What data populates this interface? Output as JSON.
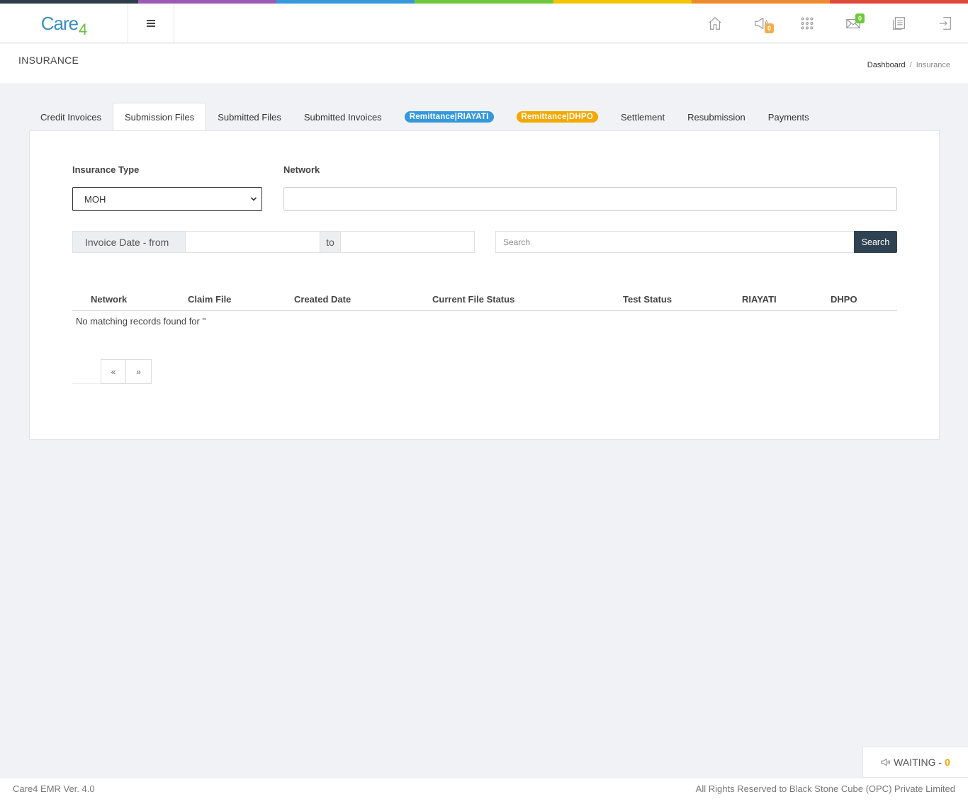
{
  "colors": {
    "stripe": [
      "#2f3d4a",
      "#9b59b6",
      "#3498db",
      "#6dc93a",
      "#f5c400",
      "#ee8a2b",
      "#e0483a"
    ],
    "remit_riayati": "#3498db",
    "remit_dhpo": "#f5a800",
    "search_button": "#2f4252",
    "badge_announce": "#f0ad4e",
    "badge_mail": "#6dc93a"
  },
  "header": {
    "logo_text": "Care",
    "logo_suffix": "4",
    "icons": [
      "home-icon",
      "megaphone-icon",
      "apps-grid-icon",
      "mail-icon",
      "document-icon",
      "logout-icon"
    ],
    "announce_count": "0",
    "mail_count": "0"
  },
  "page": {
    "title": "INSURANCE",
    "breadcrumb": {
      "root": "Dashboard",
      "separator": "/",
      "current": "Insurance"
    }
  },
  "tabs": [
    {
      "label": "Credit Invoices"
    },
    {
      "label": "Submission Files",
      "active": true
    },
    {
      "label": "Submitted Files"
    },
    {
      "label": "Submitted Invoices"
    },
    {
      "label": "Remittance|RIAYATI",
      "pill": true
    },
    {
      "label": "Remittance|DHPO",
      "pill": true
    },
    {
      "label": "Settlement"
    },
    {
      "label": "Resubmission"
    },
    {
      "label": "Payments"
    }
  ],
  "filters": {
    "insurance_type_label": "Insurance Type",
    "insurance_type_value": "MOH",
    "network_label": "Network",
    "network_value": "",
    "date_from_label": "Invoice Date - from",
    "date_to_label": "to",
    "date_from_value": "",
    "date_to_value": "",
    "search_placeholder": "Search",
    "search_button": "Search"
  },
  "table": {
    "columns": [
      "Network",
      "Claim File",
      "Created Date",
      "Current File Status",
      "Test Status",
      "RIAYATI",
      "DHPO"
    ],
    "empty_message": "No matching records found for ''"
  },
  "pagination": {
    "prev": "«",
    "next": "»"
  },
  "waiting": {
    "label": "WAITING -",
    "count": "0"
  },
  "footer": {
    "version": "Care4 EMR Ver. 4.0",
    "copyright": "All Rights Reserved to Black Stone Cube (OPC) Private Limited"
  }
}
